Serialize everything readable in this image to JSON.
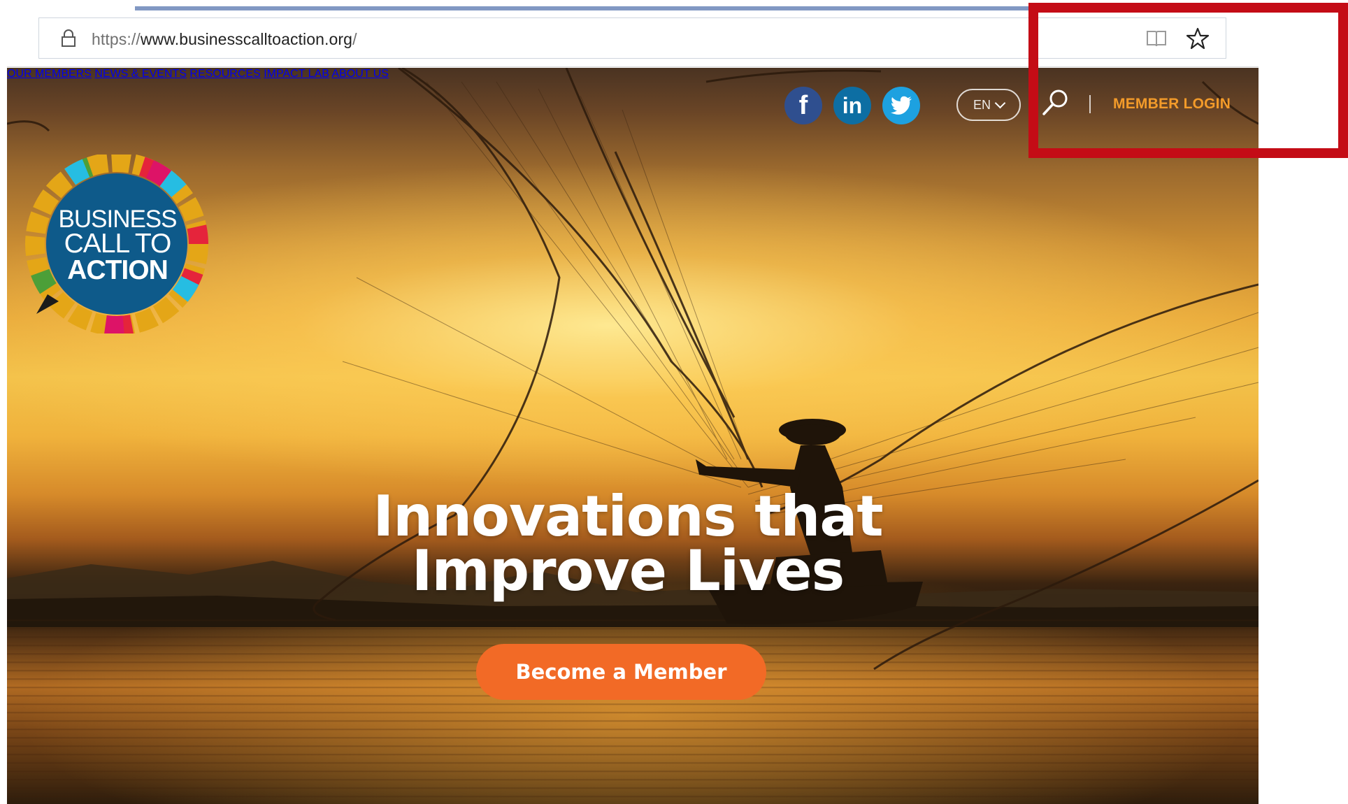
{
  "browser": {
    "url_protocol": "https://",
    "url_host": "www.businesscalltoaction.org",
    "url_slash": "/",
    "icons": [
      "lock-icon",
      "reading-view-icon",
      "favorites-star-icon"
    ]
  },
  "header": {
    "logo_text": [
      "BUSINESS",
      "CALL TO",
      "ACTION"
    ],
    "social_icons": [
      "facebook-icon",
      "linkedin-icon",
      "twitter-icon"
    ],
    "facebook_glyph": "f",
    "linkedin_glyph": "in",
    "language": "EN",
    "member_login": "MEMBER LOGIN",
    "accent_color": "#f39b2a"
  },
  "nav": {
    "items": [
      "OUR MEMBERS",
      "NEWS & EVENTS",
      "RESOURCES",
      "IMPACT LAB",
      "ABOUT US"
    ]
  },
  "hero": {
    "headline_line1": "Innovations that",
    "headline_line2": "Improve Lives",
    "cta_label": "Become a Member",
    "cta_color": "#f26a26"
  },
  "annotation": {
    "highlight_color": "#c40c16"
  }
}
